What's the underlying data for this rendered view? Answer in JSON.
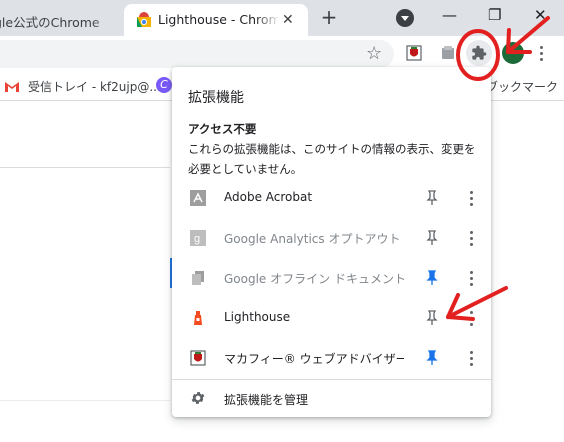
{
  "tabs": [
    {
      "title": "gle公式のChrome"
    },
    {
      "title": "Lighthouse - Chrome"
    }
  ],
  "new_tab_label": "+",
  "window_controls": {
    "minimize": "—",
    "restore": "❐",
    "close": "✕"
  },
  "bookmarks": [
    {
      "label": "受信トレイ - kf2ujp@..."
    },
    {
      "label": "ブックマーク"
    }
  ],
  "icons": [
    "star-icon",
    "puzzle-icon",
    "avatar-icon",
    "gmail-icon",
    "pin-icon",
    "gear-icon",
    "more-vert-icon",
    "chevron-down-icon"
  ],
  "popup": {
    "title": "拡張機能",
    "section_heading": "アクセス不要",
    "section_desc": "これらの拡張機能は、このサイトの情報の表示、変更を必要としていません。",
    "extensions": [
      {
        "name": "Adobe Acrobat",
        "pinned": false,
        "dim": false
      },
      {
        "name": "Google Analytics オプトアウト アド...",
        "pinned": false,
        "dim": true
      },
      {
        "name": "Google オフライン ドキュメント",
        "pinned": true,
        "dim": true
      },
      {
        "name": "Lighthouse",
        "pinned": false,
        "dim": false
      },
      {
        "name": "マカフィー® ウェブアドバイザー",
        "pinned": true,
        "dim": false
      }
    ],
    "manage_label": "拡張機能を管理"
  },
  "colors": {
    "accent": "#1a73e8",
    "annotation": "#e32020",
    "tabstrip": "#dee1e6"
  }
}
